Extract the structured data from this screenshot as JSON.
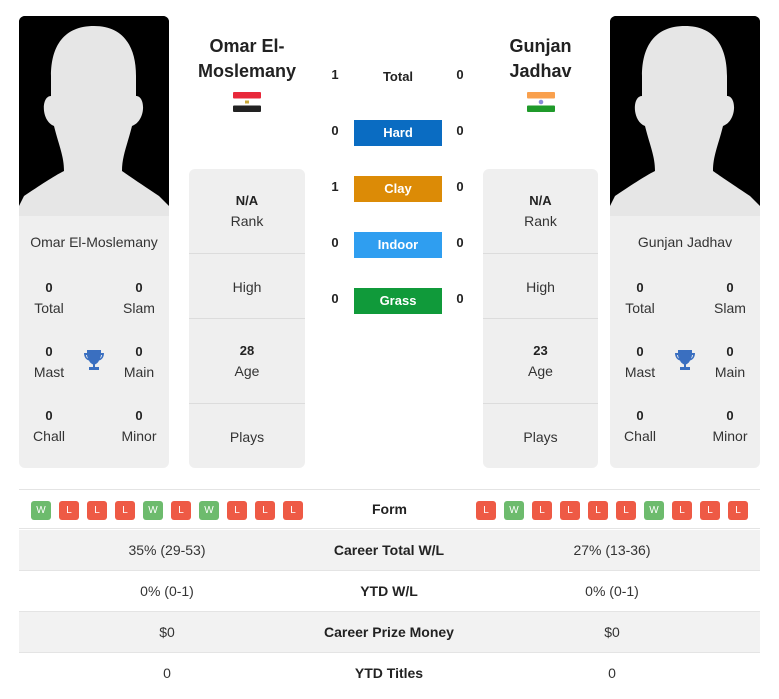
{
  "player1": {
    "name_line1": "Omar El-",
    "name_line2": "Moslemany",
    "full_name": "Omar El-Moslemany",
    "country": "Egypt",
    "flag_icon": "egypt-flag-icon",
    "titles": {
      "total": "0",
      "total_label": "Total",
      "slam": "0",
      "slam_label": "Slam",
      "mast": "0",
      "mast_label": "Mast",
      "main": "0",
      "main_label": "Main",
      "chall": "0",
      "chall_label": "Chall",
      "minor": "0",
      "minor_label": "Minor"
    },
    "rank": "N/A",
    "rank_label": "Rank",
    "high_label": "High",
    "age": "28",
    "age_label": "Age",
    "plays_label": "Plays",
    "form": [
      "W",
      "L",
      "L",
      "L",
      "W",
      "L",
      "W",
      "L",
      "L",
      "L"
    ]
  },
  "player2": {
    "name_line1": "Gunjan",
    "name_line2": "Jadhav",
    "full_name": "Gunjan Jadhav",
    "country": "India",
    "flag_icon": "india-flag-icon",
    "titles": {
      "total": "0",
      "total_label": "Total",
      "slam": "0",
      "slam_label": "Slam",
      "mast": "0",
      "mast_label": "Mast",
      "main": "0",
      "main_label": "Main",
      "chall": "0",
      "chall_label": "Chall",
      "minor": "0",
      "minor_label": "Minor"
    },
    "rank": "N/A",
    "rank_label": "Rank",
    "high_label": "High",
    "age": "23",
    "age_label": "Age",
    "plays_label": "Plays",
    "form": [
      "L",
      "W",
      "L",
      "L",
      "L",
      "L",
      "W",
      "L",
      "L",
      "L"
    ]
  },
  "h2h": {
    "total": {
      "label": "Total",
      "p1": "1",
      "p2": "0"
    },
    "surfaces": [
      {
        "label": "Hard",
        "p1": "0",
        "p2": "0",
        "color": "#0a6cc2"
      },
      {
        "label": "Clay",
        "p1": "1",
        "p2": "0",
        "color": "#dc8b06"
      },
      {
        "label": "Indoor",
        "p1": "0",
        "p2": "0",
        "color": "#2f9ef0"
      },
      {
        "label": "Grass",
        "p1": "0",
        "p2": "0",
        "color": "#109a3a"
      }
    ]
  },
  "form_label": "Form",
  "table": [
    {
      "label": "Career Total W/L",
      "p1": "35% (29-53)",
      "p2": "27% (13-36)"
    },
    {
      "label": "YTD W/L",
      "p1": "0% (0-1)",
      "p2": "0% (0-1)"
    },
    {
      "label": "Career Prize Money",
      "p1": "$0",
      "p2": "$0"
    },
    {
      "label": "YTD Titles",
      "p1": "0",
      "p2": "0"
    }
  ]
}
